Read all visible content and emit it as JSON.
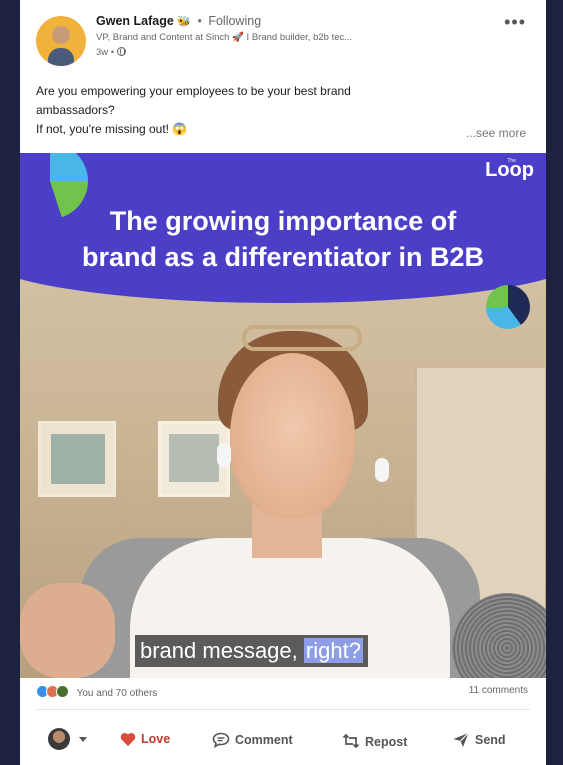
{
  "post": {
    "author": {
      "name": "Gwen Lafage",
      "name_emoji": "🐝",
      "follow_status": "Following",
      "headline": "VP, Brand and Content at Sinch 🚀 I Brand builder, b2b tec...",
      "time": "3w"
    },
    "text_line1": "Are you empowering your employees to be your best brand",
    "text_line2": "ambassadors?",
    "text_line3": "If not, you're missing out! 😱",
    "see_more": "...see more"
  },
  "video": {
    "logo": "Loop",
    "logo_small": "The",
    "title_line1": "The growing importance of",
    "title_line2": "brand as a differentiator in B2B",
    "caption_main": "brand message,",
    "caption_highlight": "right?"
  },
  "social": {
    "reactions_text": "You and 70 others",
    "comments_text": "11 comments"
  },
  "actions": {
    "love": "Love",
    "comment": "Comment",
    "repost": "Repost",
    "send": "Send"
  },
  "colors": {
    "banner": "#4b3fc8",
    "love": "#c0392b",
    "caption_highlight": "#8d9de8"
  }
}
